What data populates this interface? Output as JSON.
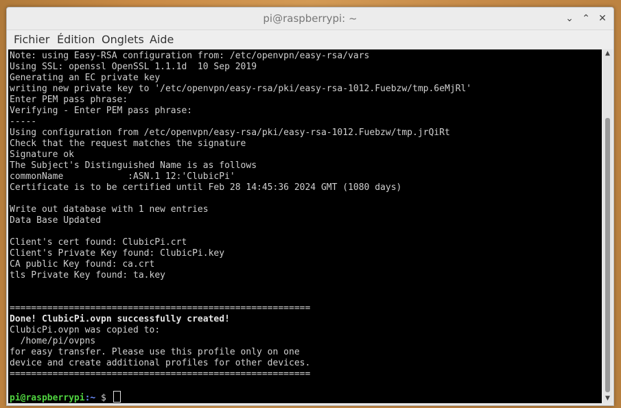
{
  "window": {
    "title": "pi@raspberrypi: ~",
    "controls": {
      "minimize": "⌄",
      "maximize": "⌃",
      "close": "✕"
    }
  },
  "menubar": {
    "items": [
      "Fichier",
      "Édition",
      "Onglets",
      "Aide"
    ]
  },
  "terminal": {
    "lines": [
      "Note: using Easy-RSA configuration from: /etc/openvpn/easy-rsa/vars",
      "Using SSL: openssl OpenSSL 1.1.1d  10 Sep 2019",
      "Generating an EC private key",
      "writing new private key to '/etc/openvpn/easy-rsa/pki/easy-rsa-1012.Fuebzw/tmp.6eMjRl'",
      "Enter PEM pass phrase:",
      "Verifying - Enter PEM pass phrase:",
      "-----",
      "Using configuration from /etc/openvpn/easy-rsa/pki/easy-rsa-1012.Fuebzw/tmp.jrQiRt",
      "Check that the request matches the signature",
      "Signature ok",
      "The Subject's Distinguished Name is as follows",
      "commonName            :ASN.1 12:'ClubicPi'",
      "Certificate is to be certified until Feb 28 14:45:36 2024 GMT (1080 days)",
      "",
      "Write out database with 1 new entries",
      "Data Base Updated",
      "",
      "Client's cert found: ClubicPi.crt",
      "Client's Private Key found: ClubicPi.key",
      "CA public Key found: ca.crt",
      "tls Private Key found: ta.key",
      "",
      "",
      "========================================================",
      "Done! ClubicPi.ovpn successfully created!",
      "ClubicPi.ovpn was copied to:",
      "  /home/pi/ovpns",
      "for easy transfer. Please use this profile only on one",
      "device and create additional profiles for other devices.",
      "========================================================",
      ""
    ],
    "bold_line_index": 24,
    "prompt": {
      "user": "pi@raspberrypi",
      "path": ":~",
      "symbol": " $ "
    }
  },
  "scrollbar": {
    "up": "▲",
    "down": "▼"
  }
}
